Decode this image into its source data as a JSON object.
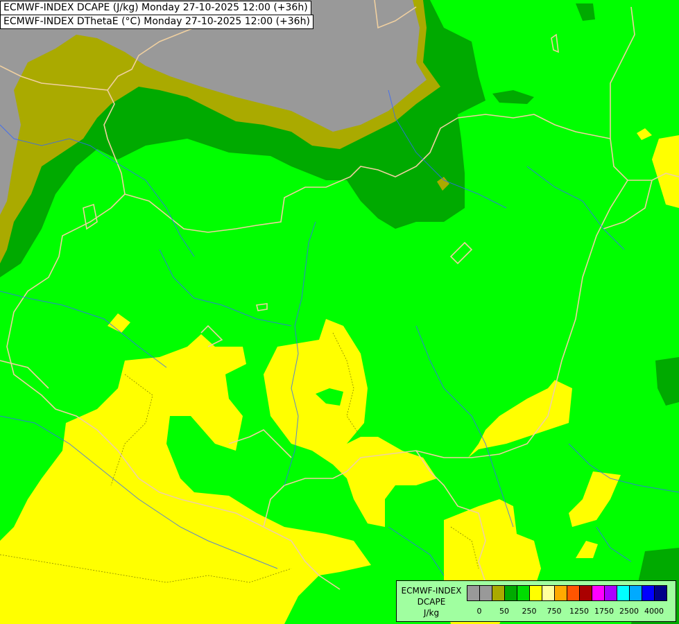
{
  "titles": {
    "line1": "ECMWF-INDEX DCAPE (J/kg) Monday 27-10-2025 12:00 (+36h)",
    "line2": "ECMWF-INDEX DThetaE (°C) Monday 27-10-2025 12:00 (+36h)"
  },
  "colors": {
    "below_zero": "#999999",
    "olive": "#aaaa00",
    "dark_green": "#00aa00",
    "green": "#00ff00",
    "yellow": "#ffff00",
    "legend_bg": "#a0ffa0",
    "border_line": "#f0d0a0",
    "river_line": "#3366ff"
  },
  "legend": {
    "label_line1": "ECMWF-INDEX",
    "label_line2": "DCAPE",
    "label_line3": "J/kg",
    "swatches": [
      "#999999",
      "#999999",
      "#aaaa00",
      "#00aa00",
      "#00dd00",
      "#ffff00",
      "#ffffa0",
      "#ffaa00",
      "#ff5500",
      "#aa0000",
      "#ff00ff",
      "#aa00ff",
      "#00ffff",
      "#00aaff",
      "#0000ff",
      "#000088"
    ],
    "ticks": [
      {
        "label": "0",
        "index": 1
      },
      {
        "label": "50",
        "index": 3
      },
      {
        "label": "250",
        "index": 5
      },
      {
        "label": "750",
        "index": 7
      },
      {
        "label": "1250",
        "index": 9
      },
      {
        "label": "1750",
        "index": 11
      },
      {
        "label": "2500",
        "index": 13
      },
      {
        "label": "4000",
        "index": 15
      }
    ]
  }
}
